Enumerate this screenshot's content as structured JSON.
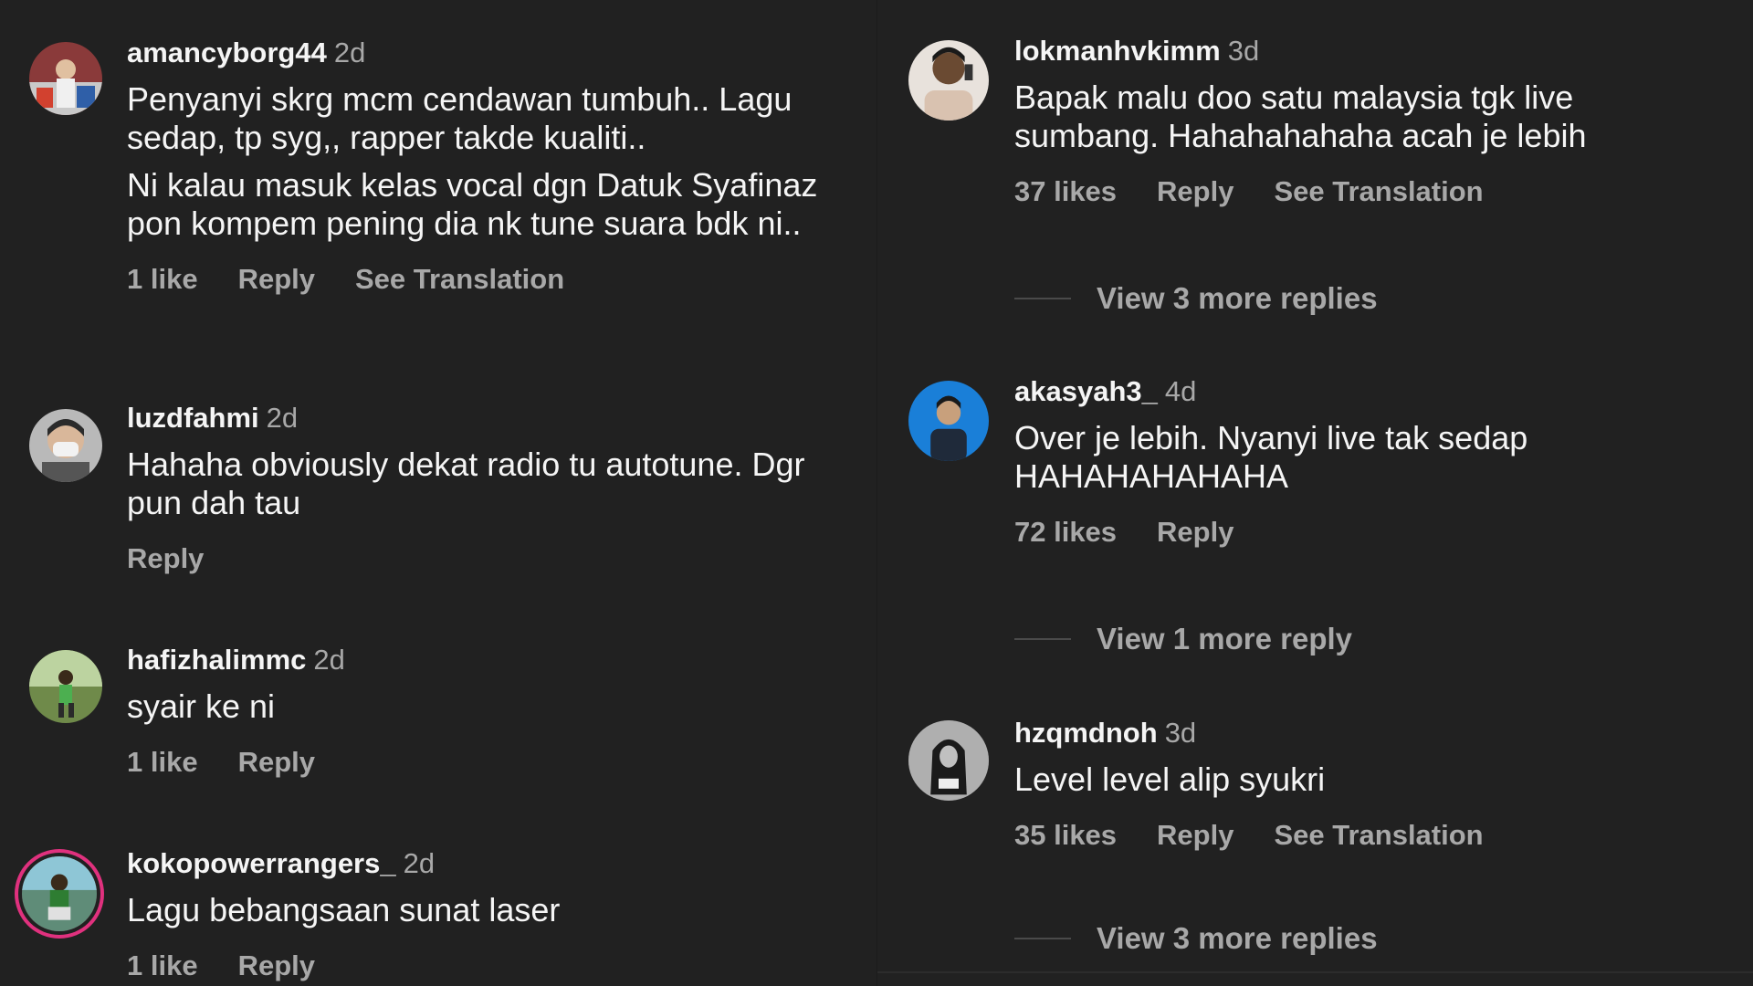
{
  "left": [
    {
      "username": "amancyborg44",
      "time": "2d",
      "lines": [
        "Penyanyi skrg mcm cendawan tumbuh.. Lagu sedap, tp syg,, rapper takde kualiti..",
        "Ni kalau masuk kelas vocal dgn Datuk Syafinaz pon kompem pening dia nk tune suara bdk ni.."
      ],
      "likes": "1 like",
      "reply": "Reply",
      "translation": "See Translation",
      "avatar_color": "#8a3a3a"
    },
    {
      "username": "luzdfahmi",
      "time": "2d",
      "lines": [
        "Hahaha obviously dekat radio tu autotune. Dgr pun dah tau"
      ],
      "reply": "Reply",
      "avatar_color": "#b9b9b9"
    },
    {
      "username": "hafizhalimmc",
      "time": "2d",
      "lines": [
        "syair ke ni"
      ],
      "likes": "1 like",
      "reply": "Reply",
      "avatar_color": "#6f8a4a"
    },
    {
      "username": "kokopowerrangers_",
      "time": "2d",
      "lines": [
        "Lagu bebangsaan sunat laser"
      ],
      "likes": "1 like",
      "reply": "Reply",
      "avatar_color": "#5f8c78"
    }
  ],
  "right": [
    {
      "username": "lokmanhvkimm",
      "time": "3d",
      "lines": [
        "Bapak malu doo satu malaysia tgk live sumbang. Hahahahahaha acah je lebih"
      ],
      "likes": "37 likes",
      "reply": "Reply",
      "translation": "See Translation",
      "view_replies": "View 3 more replies",
      "avatar_color": "#d9c2b0"
    },
    {
      "username": "akasyah3_",
      "time": "4d",
      "lines": [
        "Over je lebih. Nyanyi live tak sedap HAHAHAHAHAHA"
      ],
      "likes": "72 likes",
      "reply": "Reply",
      "view_replies": "View 1 more reply",
      "avatar_color": "#1a7fd8"
    },
    {
      "username": "hzqmdnoh",
      "time": "3d",
      "lines": [
        "Level level alip syukri"
      ],
      "likes": "35 likes",
      "reply": "Reply",
      "translation": "See Translation",
      "view_replies": "View 3 more replies",
      "avatar_color": "#9a9a9a"
    }
  ]
}
